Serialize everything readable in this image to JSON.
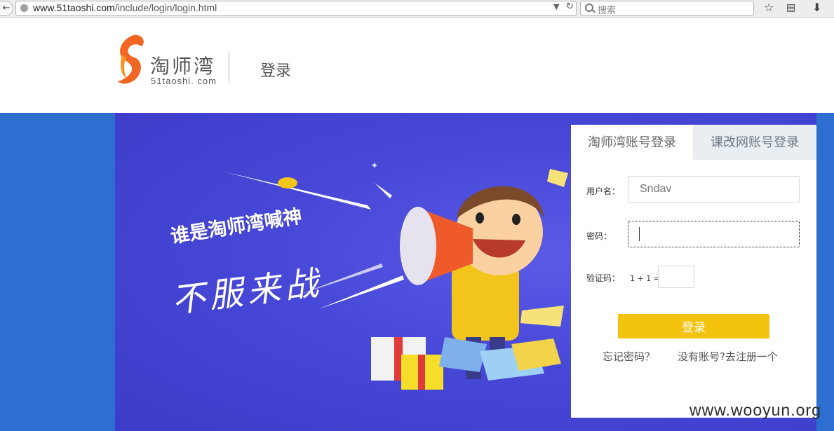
{
  "browser": {
    "back_glyph": "←",
    "url_host": "www.51taoshi.com",
    "url_path": "/include/login/login.html",
    "search_placeholder": "搜索",
    "icons": [
      "globe-icon",
      "dropdown-icon",
      "reload-icon",
      "search-icon",
      "bookmark-star-icon",
      "reading-list-icon",
      "download-icon"
    ]
  },
  "header": {
    "logo_name": "淘师湾",
    "logo_domain": "51taoshi. com",
    "page_title": "登录"
  },
  "banner": {
    "slogan_line1": "谁是淘师湾喊神",
    "slogan_line2": "不服来战"
  },
  "login": {
    "tabs": [
      {
        "label": "淘师湾账号登录",
        "active": true
      },
      {
        "label": "课改网账号登录",
        "active": false
      }
    ],
    "username_label": "用户名：",
    "username_value": "Sndav",
    "password_label": "密码：",
    "captcha_label": "验证码：",
    "captcha_question": "1 + 1 =",
    "submit_label": "登录",
    "forgot_label": "忘记密码？",
    "register_label": "没有账号?去注册一个"
  },
  "watermark": "www.wooyun.org",
  "colors": {
    "brand_orange": "#f26522",
    "button_yellow": "#f3c20d",
    "banner_blue": "#2c6fd0",
    "banner_purple": "#4848d8"
  }
}
